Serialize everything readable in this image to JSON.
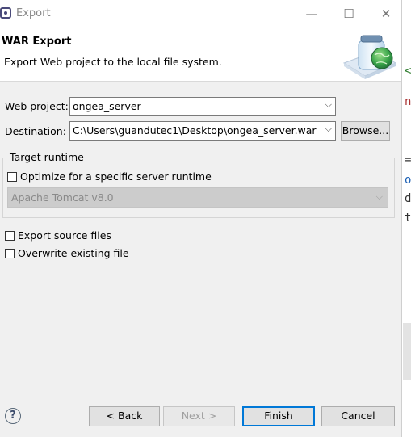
{
  "window": {
    "title": "Export",
    "controls": {
      "minimize": "—",
      "maximize": "☐",
      "close": "✕"
    }
  },
  "banner": {
    "title": "WAR Export",
    "description": "Export Web project to the local file system.",
    "icon": "export-wizard-jar-globe-icon"
  },
  "form": {
    "web_project": {
      "label": "Web project:",
      "value": "ongea_server"
    },
    "destination": {
      "label": "Destination:",
      "value": "C:\\Users\\guandutec1\\Desktop\\ongea_server.war",
      "browse_label": "Browse..."
    },
    "target_runtime": {
      "legend": "Target runtime",
      "optimize_label": "Optimize for a specific server runtime",
      "optimize_checked": false,
      "runtime_value": "Apache Tomcat v8.0",
      "runtime_enabled": false
    },
    "export_source": {
      "label": "Export source files",
      "checked": false
    },
    "overwrite": {
      "label": "Overwrite existing file",
      "checked": false
    }
  },
  "buttons": {
    "back": "< Back",
    "next": "Next >",
    "finish": "Finish",
    "cancel": "Cancel"
  },
  "colors": {
    "window_bg": "#f0f0f0",
    "banner_bg": "#ffffff",
    "focus_border": "#0078d7",
    "disabled_select": "#cccccc"
  }
}
